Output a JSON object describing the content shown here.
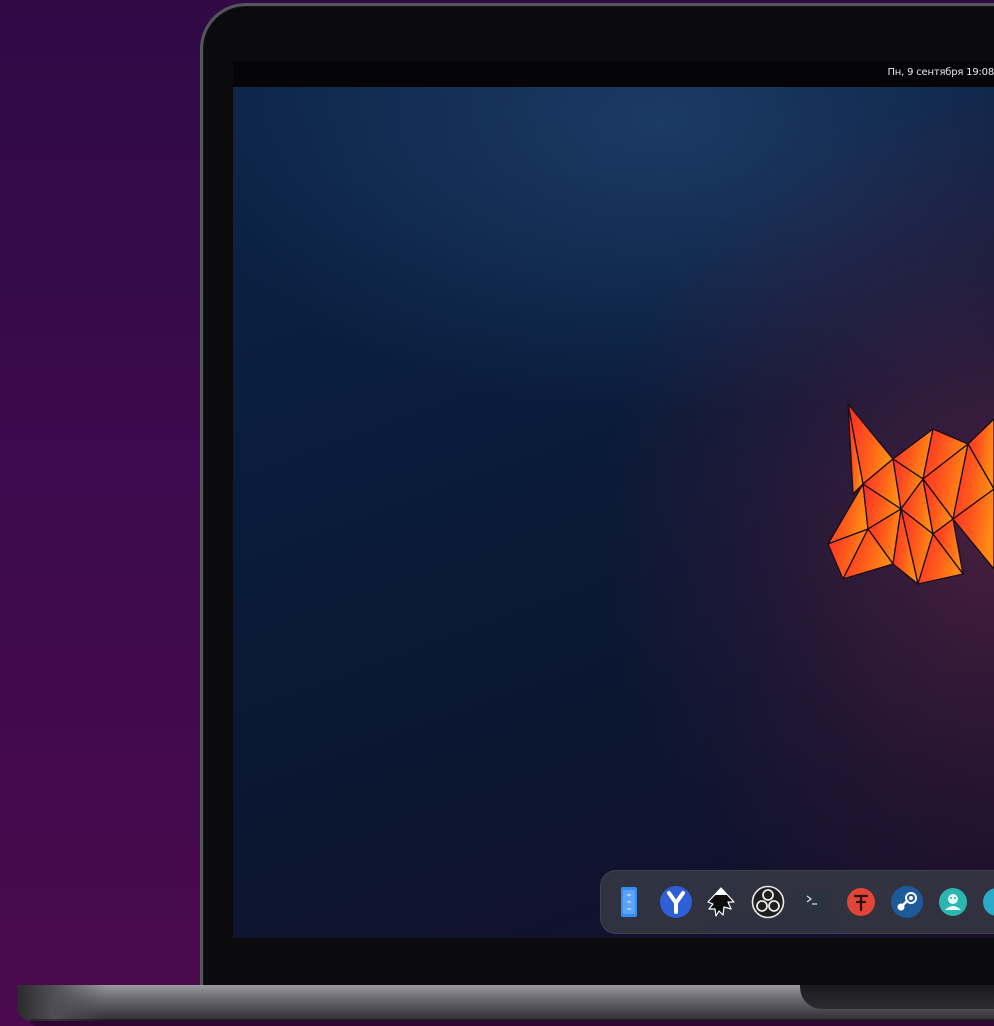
{
  "topbar": {
    "clock": "Пн, 9 сентября 19:08"
  },
  "wallpaper": {
    "logo_colors": [
      "#ff2b2b",
      "#ff5a1e",
      "#ff8a10"
    ]
  },
  "dock": {
    "apps": [
      {
        "name": "files",
        "icon": "file-manager-icon",
        "color": "#3b8cf0"
      },
      {
        "name": "yandex-browser",
        "icon": "yandex-browser-icon",
        "color": "#2e5fd6"
      },
      {
        "name": "inkscape",
        "icon": "inkscape-icon",
        "color": "#111111"
      },
      {
        "name": "obs-studio",
        "icon": "obs-icon",
        "color": "#1e1e1e"
      },
      {
        "name": "terminal",
        "icon": "terminal-icon",
        "color": "#2c3340"
      },
      {
        "name": "app-red",
        "icon": "red-app-icon",
        "color": "#e04538"
      },
      {
        "name": "steam",
        "icon": "steam-icon",
        "color": "#1d5a9a"
      },
      {
        "name": "app-teal",
        "icon": "teal-app-icon",
        "color": "#2bb6b0"
      },
      {
        "name": "app-partial",
        "icon": "partial-app-icon",
        "color": "#2aa9c9"
      }
    ]
  }
}
